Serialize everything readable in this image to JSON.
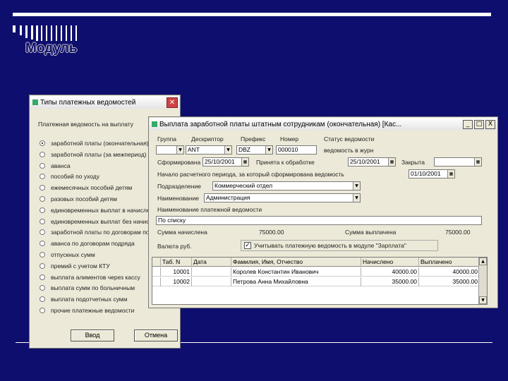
{
  "slide": {
    "title": "Модуль"
  },
  "types_dialog": {
    "title": "Типы платежных ведомостей",
    "group_label": "Платежная ведомость на выплату",
    "options": [
      {
        "label": "заработной платы (окончательная)",
        "selected": true
      },
      {
        "label": "заработной платы (за межпериод)",
        "selected": false
      },
      {
        "label": "аванса",
        "selected": false
      },
      {
        "label": "пособий по уходу",
        "selected": false
      },
      {
        "label": "ежемесячных пособий детям",
        "selected": false
      },
      {
        "label": "разовых пособий детям",
        "selected": false
      },
      {
        "label": "единовременных выплат в начислении",
        "selected": false
      },
      {
        "label": "единовременных выплат без начисления",
        "selected": false
      },
      {
        "label": "заработной платы по договорам подряда",
        "selected": false
      },
      {
        "label": "аванса по договорам подряда",
        "selected": false
      },
      {
        "label": "отпускных сумм",
        "selected": false
      },
      {
        "label": "премий с учетом КТУ",
        "selected": false
      },
      {
        "label": "выплата алиментов через кассу",
        "selected": false
      },
      {
        "label": "выплата сумм по больничным",
        "selected": false
      },
      {
        "label": "выплата подотчетных сумм",
        "selected": false
      },
      {
        "label": "прочие платежные ведомости",
        "selected": false
      }
    ],
    "ok_label": "Ввод",
    "cancel_label": "Отмена"
  },
  "pay_window": {
    "title": "Выплата заработной платы штатным сотрудникам (окончательная) [Кас...",
    "min_label": "_",
    "max_label": "□",
    "close_label": "X",
    "headers": {
      "group": "Группа",
      "descriptor": "Дескриптор",
      "prefix": "Префикс",
      "number": "Номер",
      "status": "Статус ведомости"
    },
    "group_value": "",
    "descriptor_value": "ANT",
    "prefix_value": "DBZ",
    "number_value": "000010",
    "status_value": "ведомость в журн",
    "processed_label": "Сформирована",
    "processed_date": "25/10/2001",
    "accepted_label": "Принята к обработке",
    "accepted_date": "25/10/2001",
    "closed_label": "Закрыта",
    "closed_value": "",
    "period_label": "Начало расчетного периода, за который сформирована ведомость",
    "period_date": "01/10/2001",
    "division_label": "Подразделение",
    "division_value": "Коммерческий отдел",
    "name_label": "Наименование",
    "name_value": "Администрация",
    "sheet_name_label": "Наименование платежной ведомости",
    "sheet_name_value": "По списку",
    "accrued_label": "Сумма начислена",
    "accrued_value": "75000.00",
    "paid_label": "Сумма выплачена",
    "paid_value": "75000.00",
    "currency_label": "Валюта   руб.",
    "consider_checked": true,
    "consider_label": "Учитывать платежную ведомость в модуле \"Зарплата\"",
    "table": {
      "columns": [
        "Таб. N",
        "Дата",
        "Фамилия, Имя, Отчество",
        "Начислено",
        "Выплачено"
      ],
      "rows": [
        {
          "tab": "10001",
          "date": "",
          "name": "Королев Константин Иванович",
          "accrued": "40000.00",
          "paid": "40000.00"
        },
        {
          "tab": "10002",
          "date": "",
          "name": "Петрова Анна Михайловна",
          "accrued": "35000.00",
          "paid": "35000.00"
        }
      ]
    }
  }
}
